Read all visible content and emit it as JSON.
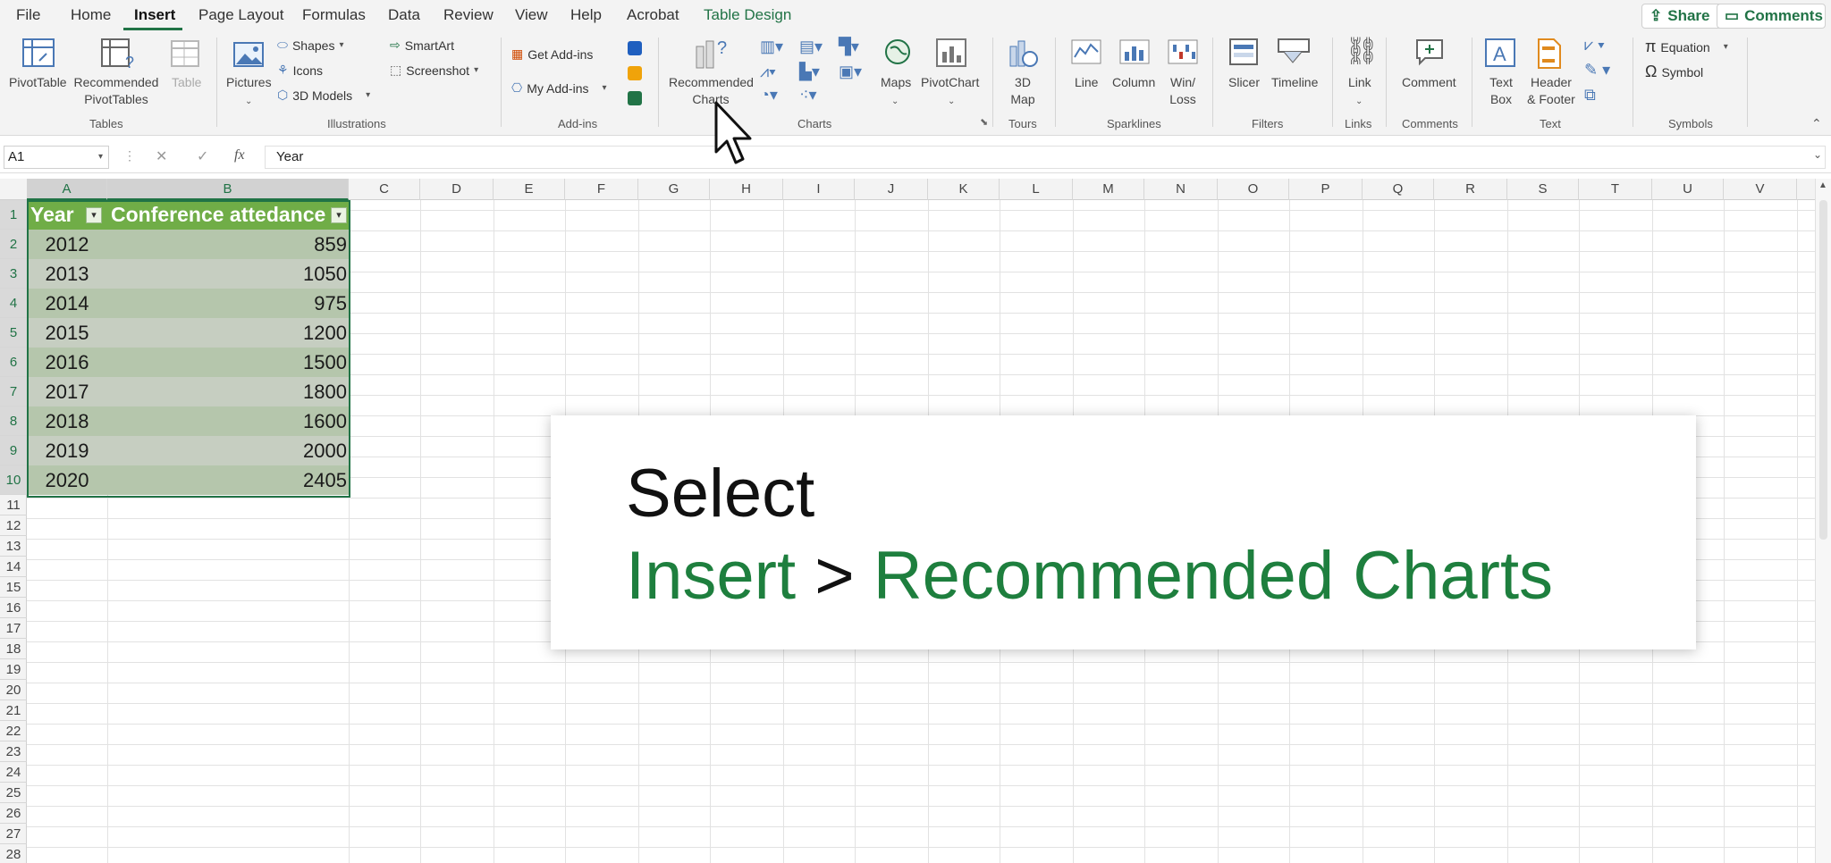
{
  "menu": {
    "tabs": [
      "File",
      "Home",
      "Insert",
      "Page Layout",
      "Formulas",
      "Data",
      "Review",
      "View",
      "Help",
      "Acrobat",
      "Table Design"
    ],
    "share": "Share",
    "comments": "Comments"
  },
  "ribbon": {
    "tables": {
      "pivottable": "PivotTable",
      "recommended_l1": "Recommended",
      "recommended_l2": "PivotTables",
      "table": "Table",
      "group": "Tables"
    },
    "illustrations": {
      "pictures": "Pictures",
      "shapes": "Shapes",
      "icons": "Icons",
      "models": "3D Models",
      "smartart": "SmartArt",
      "screenshot": "Screenshot",
      "group": "Illustrations"
    },
    "addins": {
      "get": "Get Add-ins",
      "my": "My Add-ins",
      "group": "Add-ins"
    },
    "charts": {
      "rec_l1": "Recommended",
      "rec_l2": "Charts",
      "maps": "Maps",
      "pivotchart": "PivotChart",
      "group": "Charts"
    },
    "tours": {
      "map_l1": "3D",
      "map_l2": "Map",
      "group": "Tours"
    },
    "sparklines": {
      "line": "Line",
      "column": "Column",
      "winloss_l1": "Win/",
      "winloss_l2": "Loss",
      "group": "Sparklines"
    },
    "filters": {
      "slicer": "Slicer",
      "timeline": "Timeline",
      "group": "Filters"
    },
    "links": {
      "link": "Link",
      "group": "Links"
    },
    "comments": {
      "comment": "Comment",
      "group": "Comments"
    },
    "text": {
      "textbox_l1": "Text",
      "textbox_l2": "Box",
      "hf_l1": "Header",
      "hf_l2": "& Footer",
      "group": "Text"
    },
    "symbols": {
      "equation": "Equation",
      "symbol": "Symbol",
      "group": "Symbols"
    }
  },
  "formula": {
    "namebox": "A1",
    "content": "Year",
    "cancel": "✕",
    "enter": "✓",
    "fx": "fx"
  },
  "columns": [
    "A",
    "B",
    "C",
    "D",
    "E",
    "F",
    "G",
    "H",
    "I",
    "J",
    "K",
    "L",
    "M",
    "N",
    "O",
    "P",
    "Q",
    "R",
    "S",
    "T",
    "U",
    "V"
  ],
  "rows": [
    "1",
    "2",
    "3",
    "4",
    "5",
    "6",
    "7",
    "8",
    "9",
    "10",
    "11",
    "12",
    "13",
    "14",
    "15",
    "16",
    "17",
    "18",
    "19",
    "20",
    "21",
    "22",
    "23",
    "24",
    "25",
    "26",
    "27",
    "28"
  ],
  "table": {
    "headers": [
      "Year",
      "Conference attedance"
    ],
    "rows": [
      [
        "2012",
        "859"
      ],
      [
        "2013",
        "1050"
      ],
      [
        "2014",
        "975"
      ],
      [
        "2015",
        "1200"
      ],
      [
        "2016",
        "1500"
      ],
      [
        "2017",
        "1800"
      ],
      [
        "2018",
        "1600"
      ],
      [
        "2019",
        "2000"
      ],
      [
        "2020",
        "2405"
      ]
    ]
  },
  "callout": {
    "line1": "Select",
    "insert": "Insert",
    "arrow": ">",
    "target": "Recommended Charts"
  },
  "colors": {
    "accent": "#217346",
    "table_header": "#70ad47",
    "callout_green": "#1e7f3e"
  }
}
